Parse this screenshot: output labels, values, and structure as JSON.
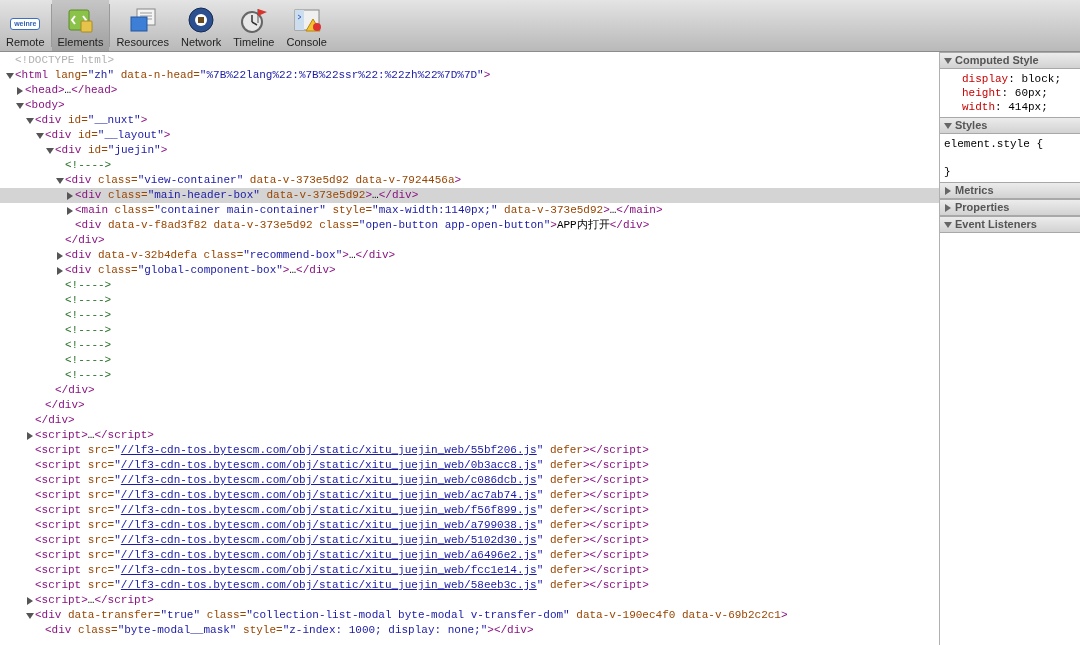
{
  "toolbar": [
    {
      "label": "Remote",
      "selected": false,
      "kind": "logo",
      "logo_text": "weinre"
    },
    {
      "label": "Elements",
      "selected": true,
      "kind": "elements"
    },
    {
      "label": "Resources",
      "selected": false,
      "kind": "resources"
    },
    {
      "label": "Network",
      "selected": false,
      "kind": "network"
    },
    {
      "label": "Timeline",
      "selected": false,
      "kind": "timeline"
    },
    {
      "label": "Console",
      "selected": false,
      "kind": "console"
    }
  ],
  "dom_tree": [
    {
      "selected": false,
      "tokens": [
        {
          "kind": "doctype",
          "text": "<!DOCTYPE html>"
        }
      ]
    },
    {
      "selected": false,
      "expanded": true,
      "tokens": [
        {
          "kind": "tag",
          "text": "<html"
        },
        {
          "kind": "attr",
          "text": " lang="
        },
        {
          "kind": "value",
          "text": "\"zh\""
        },
        {
          "kind": "attr",
          "text": " data-n-head="
        },
        {
          "kind": "value",
          "text": "\"%7B%22lang%22:%7B%22ssr%22:%22zh%22%7D%7D\""
        },
        {
          "kind": "tag",
          "text": ">"
        }
      ],
      "children": [
        {
          "selected": false,
          "expanded": false,
          "tokens": [
            {
              "kind": "tag",
              "text": "<head>"
            },
            {
              "kind": "text",
              "text": "…"
            },
            {
              "kind": "tag",
              "text": "</head>"
            }
          ]
        },
        {
          "selected": false,
          "expanded": true,
          "tokens": [
            {
              "kind": "tag",
              "text": "<body>"
            }
          ],
          "children": [
            {
              "selected": false,
              "expanded": true,
              "tokens": [
                {
                  "kind": "tag",
                  "text": "<div"
                },
                {
                  "kind": "attr",
                  "text": " id="
                },
                {
                  "kind": "value",
                  "text": "\"__nuxt\""
                },
                {
                  "kind": "tag",
                  "text": ">"
                }
              ],
              "closing": [
                {
                  "kind": "tag",
                  "text": "</div>"
                }
              ],
              "children": [
                {
                  "selected": false,
                  "expanded": true,
                  "tokens": [
                    {
                      "kind": "tag",
                      "text": "<div"
                    },
                    {
                      "kind": "attr",
                      "text": " id="
                    },
                    {
                      "kind": "value",
                      "text": "\"__layout\""
                    },
                    {
                      "kind": "tag",
                      "text": ">"
                    }
                  ],
                  "closing": [
                    {
                      "kind": "tag",
                      "text": "</div>"
                    }
                  ],
                  "children": [
                    {
                      "selected": false,
                      "expanded": true,
                      "tokens": [
                        {
                          "kind": "tag",
                          "text": "<div"
                        },
                        {
                          "kind": "attr",
                          "text": " id="
                        },
                        {
                          "kind": "value",
                          "text": "\"juejin\""
                        },
                        {
                          "kind": "tag",
                          "text": ">"
                        }
                      ],
                      "closing": [
                        {
                          "kind": "tag",
                          "text": "</div>"
                        }
                      ],
                      "children": [
                        {
                          "selected": false,
                          "tokens": [
                            {
                              "kind": "comment",
                              "text": "<!---->"
                            }
                          ]
                        },
                        {
                          "selected": false,
                          "expanded": true,
                          "tokens": [
                            {
                              "kind": "tag",
                              "text": "<div"
                            },
                            {
                              "kind": "attr",
                              "text": " class="
                            },
                            {
                              "kind": "value",
                              "text": "\"view-container\""
                            },
                            {
                              "kind": "attr",
                              "text": " data-v-373e5d92 data-v-7924456a"
                            },
                            {
                              "kind": "tag",
                              "text": ">"
                            }
                          ],
                          "closing": [
                            {
                              "kind": "tag",
                              "text": "</div>"
                            }
                          ],
                          "children": [
                            {
                              "selected": true,
                              "expanded": false,
                              "tokens": [
                                {
                                  "kind": "tag",
                                  "text": "<div"
                                },
                                {
                                  "kind": "attr",
                                  "text": " class="
                                },
                                {
                                  "kind": "value",
                                  "text": "\"main-header-box\""
                                },
                                {
                                  "kind": "attr",
                                  "text": " data-v-373e5d92"
                                },
                                {
                                  "kind": "tag",
                                  "text": ">"
                                },
                                {
                                  "kind": "text",
                                  "text": "…"
                                },
                                {
                                  "kind": "tag",
                                  "text": "</div>"
                                }
                              ]
                            },
                            {
                              "selected": false,
                              "expanded": false,
                              "tokens": [
                                {
                                  "kind": "tag",
                                  "text": "<main"
                                },
                                {
                                  "kind": "attr",
                                  "text": " class="
                                },
                                {
                                  "kind": "value",
                                  "text": "\"container main-container\""
                                },
                                {
                                  "kind": "attr",
                                  "text": " style="
                                },
                                {
                                  "kind": "value",
                                  "text": "\"max-width:1140px;\""
                                },
                                {
                                  "kind": "attr",
                                  "text": " data-v-373e5d92"
                                },
                                {
                                  "kind": "tag",
                                  "text": ">"
                                },
                                {
                                  "kind": "text",
                                  "text": "…"
                                },
                                {
                                  "kind": "tag",
                                  "text": "</main>"
                                }
                              ]
                            },
                            {
                              "selected": false,
                              "tokens": [
                                {
                                  "kind": "tag",
                                  "text": "<div"
                                },
                                {
                                  "kind": "attr",
                                  "text": " data-v-f8ad3f82 data-v-373e5d92 class="
                                },
                                {
                                  "kind": "value",
                                  "text": "\"open-button app-open-button\""
                                },
                                {
                                  "kind": "tag",
                                  "text": ">"
                                },
                                {
                                  "kind": "text",
                                  "text": "APP内打开"
                                },
                                {
                                  "kind": "tag",
                                  "text": "</div>"
                                }
                              ]
                            }
                          ]
                        },
                        {
                          "selected": false,
                          "expanded": false,
                          "tokens": [
                            {
                              "kind": "tag",
                              "text": "<div"
                            },
                            {
                              "kind": "attr",
                              "text": " data-v-32b4defa class="
                            },
                            {
                              "kind": "value",
                              "text": "\"recommend-box\""
                            },
                            {
                              "kind": "tag",
                              "text": ">"
                            },
                            {
                              "kind": "text",
                              "text": "…"
                            },
                            {
                              "kind": "tag",
                              "text": "</div>"
                            }
                          ]
                        },
                        {
                          "selected": false,
                          "expanded": false,
                          "tokens": [
                            {
                              "kind": "tag",
                              "text": "<div"
                            },
                            {
                              "kind": "attr",
                              "text": " class="
                            },
                            {
                              "kind": "value",
                              "text": "\"global-component-box\""
                            },
                            {
                              "kind": "tag",
                              "text": ">"
                            },
                            {
                              "kind": "text",
                              "text": "…"
                            },
                            {
                              "kind": "tag",
                              "text": "</div>"
                            }
                          ]
                        },
                        {
                          "selected": false,
                          "tokens": [
                            {
                              "kind": "comment",
                              "text": "<!---->"
                            }
                          ]
                        },
                        {
                          "selected": false,
                          "tokens": [
                            {
                              "kind": "comment",
                              "text": "<!---->"
                            }
                          ]
                        },
                        {
                          "selected": false,
                          "tokens": [
                            {
                              "kind": "comment",
                              "text": "<!---->"
                            }
                          ]
                        },
                        {
                          "selected": false,
                          "tokens": [
                            {
                              "kind": "comment",
                              "text": "<!---->"
                            }
                          ]
                        },
                        {
                          "selected": false,
                          "tokens": [
                            {
                              "kind": "comment",
                              "text": "<!---->"
                            }
                          ]
                        },
                        {
                          "selected": false,
                          "tokens": [
                            {
                              "kind": "comment",
                              "text": "<!---->"
                            }
                          ]
                        },
                        {
                          "selected": false,
                          "tokens": [
                            {
                              "kind": "comment",
                              "text": "<!---->"
                            }
                          ]
                        }
                      ]
                    }
                  ]
                }
              ]
            },
            {
              "selected": false,
              "expanded": false,
              "tokens": [
                {
                  "kind": "tag",
                  "text": "<script>"
                },
                {
                  "kind": "text",
                  "text": "…"
                },
                {
                  "kind": "tag",
                  "text": "</script>"
                }
              ]
            },
            {
              "selected": false,
              "tokens": [
                {
                  "kind": "tag",
                  "text": "<script"
                },
                {
                  "kind": "attr",
                  "text": " src="
                },
                {
                  "kind": "value",
                  "text": "\""
                },
                {
                  "kind": "link",
                  "text": "//lf3-cdn-tos.bytescm.com/obj/static/xitu_juejin_web/55bf206.js"
                },
                {
                  "kind": "value",
                  "text": "\""
                },
                {
                  "kind": "attr",
                  "text": " defer"
                },
                {
                  "kind": "tag",
                  "text": "></script>"
                }
              ]
            },
            {
              "selected": false,
              "tokens": [
                {
                  "kind": "tag",
                  "text": "<script"
                },
                {
                  "kind": "attr",
                  "text": " src="
                },
                {
                  "kind": "value",
                  "text": "\""
                },
                {
                  "kind": "link",
                  "text": "//lf3-cdn-tos.bytescm.com/obj/static/xitu_juejin_web/0b3acc8.js"
                },
                {
                  "kind": "value",
                  "text": "\""
                },
                {
                  "kind": "attr",
                  "text": " defer"
                },
                {
                  "kind": "tag",
                  "text": "></script>"
                }
              ]
            },
            {
              "selected": false,
              "tokens": [
                {
                  "kind": "tag",
                  "text": "<script"
                },
                {
                  "kind": "attr",
                  "text": " src="
                },
                {
                  "kind": "value",
                  "text": "\""
                },
                {
                  "kind": "link",
                  "text": "//lf3-cdn-tos.bytescm.com/obj/static/xitu_juejin_web/c086dcb.js"
                },
                {
                  "kind": "value",
                  "text": "\""
                },
                {
                  "kind": "attr",
                  "text": " defer"
                },
                {
                  "kind": "tag",
                  "text": "></script>"
                }
              ]
            },
            {
              "selected": false,
              "tokens": [
                {
                  "kind": "tag",
                  "text": "<script"
                },
                {
                  "kind": "attr",
                  "text": " src="
                },
                {
                  "kind": "value",
                  "text": "\""
                },
                {
                  "kind": "link",
                  "text": "//lf3-cdn-tos.bytescm.com/obj/static/xitu_juejin_web/ac7ab74.js"
                },
                {
                  "kind": "value",
                  "text": "\""
                },
                {
                  "kind": "attr",
                  "text": " defer"
                },
                {
                  "kind": "tag",
                  "text": "></script>"
                }
              ]
            },
            {
              "selected": false,
              "tokens": [
                {
                  "kind": "tag",
                  "text": "<script"
                },
                {
                  "kind": "attr",
                  "text": " src="
                },
                {
                  "kind": "value",
                  "text": "\""
                },
                {
                  "kind": "link",
                  "text": "//lf3-cdn-tos.bytescm.com/obj/static/xitu_juejin_web/f56f899.js"
                },
                {
                  "kind": "value",
                  "text": "\""
                },
                {
                  "kind": "attr",
                  "text": " defer"
                },
                {
                  "kind": "tag",
                  "text": "></script>"
                }
              ]
            },
            {
              "selected": false,
              "tokens": [
                {
                  "kind": "tag",
                  "text": "<script"
                },
                {
                  "kind": "attr",
                  "text": " src="
                },
                {
                  "kind": "value",
                  "text": "\""
                },
                {
                  "kind": "link",
                  "text": "//lf3-cdn-tos.bytescm.com/obj/static/xitu_juejin_web/a799038.js"
                },
                {
                  "kind": "value",
                  "text": "\""
                },
                {
                  "kind": "attr",
                  "text": " defer"
                },
                {
                  "kind": "tag",
                  "text": "></script>"
                }
              ]
            },
            {
              "selected": false,
              "tokens": [
                {
                  "kind": "tag",
                  "text": "<script"
                },
                {
                  "kind": "attr",
                  "text": " src="
                },
                {
                  "kind": "value",
                  "text": "\""
                },
                {
                  "kind": "link",
                  "text": "//lf3-cdn-tos.bytescm.com/obj/static/xitu_juejin_web/5102d30.js"
                },
                {
                  "kind": "value",
                  "text": "\""
                },
                {
                  "kind": "attr",
                  "text": " defer"
                },
                {
                  "kind": "tag",
                  "text": "></script>"
                }
              ]
            },
            {
              "selected": false,
              "tokens": [
                {
                  "kind": "tag",
                  "text": "<script"
                },
                {
                  "kind": "attr",
                  "text": " src="
                },
                {
                  "kind": "value",
                  "text": "\""
                },
                {
                  "kind": "link",
                  "text": "//lf3-cdn-tos.bytescm.com/obj/static/xitu_juejin_web/a6496e2.js"
                },
                {
                  "kind": "value",
                  "text": "\""
                },
                {
                  "kind": "attr",
                  "text": " defer"
                },
                {
                  "kind": "tag",
                  "text": "></script>"
                }
              ]
            },
            {
              "selected": false,
              "tokens": [
                {
                  "kind": "tag",
                  "text": "<script"
                },
                {
                  "kind": "attr",
                  "text": " src="
                },
                {
                  "kind": "value",
                  "text": "\""
                },
                {
                  "kind": "link",
                  "text": "//lf3-cdn-tos.bytescm.com/obj/static/xitu_juejin_web/fcc1e14.js"
                },
                {
                  "kind": "value",
                  "text": "\""
                },
                {
                  "kind": "attr",
                  "text": " defer"
                },
                {
                  "kind": "tag",
                  "text": "></script>"
                }
              ]
            },
            {
              "selected": false,
              "tokens": [
                {
                  "kind": "tag",
                  "text": "<script"
                },
                {
                  "kind": "attr",
                  "text": " src="
                },
                {
                  "kind": "value",
                  "text": "\""
                },
                {
                  "kind": "link",
                  "text": "//lf3-cdn-tos.bytescm.com/obj/static/xitu_juejin_web/58eeb3c.js"
                },
                {
                  "kind": "value",
                  "text": "\""
                },
                {
                  "kind": "attr",
                  "text": " defer"
                },
                {
                  "kind": "tag",
                  "text": "></script>"
                }
              ]
            },
            {
              "selected": false,
              "expanded": false,
              "tokens": [
                {
                  "kind": "tag",
                  "text": "<script>"
                },
                {
                  "kind": "text",
                  "text": "…"
                },
                {
                  "kind": "tag",
                  "text": "</script>"
                }
              ]
            },
            {
              "selected": false,
              "expanded": true,
              "tokens": [
                {
                  "kind": "tag",
                  "text": "<div"
                },
                {
                  "kind": "attr",
                  "text": " data-transfer="
                },
                {
                  "kind": "value",
                  "text": "\"true\""
                },
                {
                  "kind": "attr",
                  "text": " class="
                },
                {
                  "kind": "value",
                  "text": "\"collection-list-modal byte-modal v-transfer-dom\""
                },
                {
                  "kind": "attr",
                  "text": " data-v-190ec4f0 data-v-69b2c2c1"
                },
                {
                  "kind": "tag",
                  "text": ">"
                }
              ],
              "children": [
                {
                  "selected": false,
                  "tokens": [
                    {
                      "kind": "tag",
                      "text": "<div"
                    },
                    {
                      "kind": "attr",
                      "text": " class="
                    },
                    {
                      "kind": "value",
                      "text": "\"byte-modal__mask\""
                    },
                    {
                      "kind": "attr",
                      "text": " style="
                    },
                    {
                      "kind": "value",
                      "text": "\"z-index: 1000; display: none;\""
                    },
                    {
                      "kind": "tag",
                      "text": "></div>"
                    }
                  ]
                }
              ]
            }
          ]
        }
      ]
    }
  ],
  "sidebar": [
    {
      "title": "Computed Style",
      "expanded": true,
      "kind": "computed",
      "properties": [
        {
          "name": "display",
          "value": ": block;"
        },
        {
          "name": "height",
          "value": ": 60px;"
        },
        {
          "name": "width",
          "value": ": 414px;"
        }
      ]
    },
    {
      "title": "Styles",
      "expanded": true,
      "kind": "rule",
      "selector": "element.style {",
      "close": "}"
    },
    {
      "title": "Metrics",
      "expanded": false
    },
    {
      "title": "Properties",
      "expanded": false
    },
    {
      "title": "Event Listeners",
      "expanded": true
    }
  ]
}
